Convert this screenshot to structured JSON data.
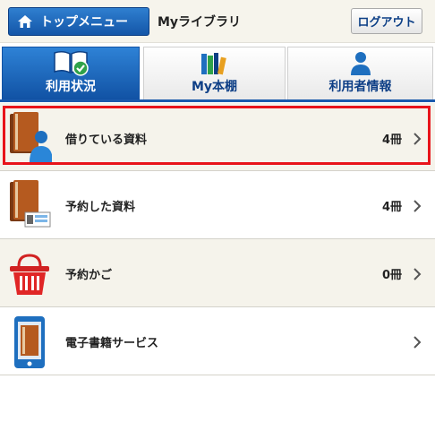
{
  "header": {
    "top_menu_label": "トップメニュー",
    "library_title": "Myライブラリ",
    "logout_label": "ログアウト"
  },
  "tabs": [
    {
      "label": "利用状況",
      "active": true,
      "icon": "book-check-icon"
    },
    {
      "label": "My本棚",
      "active": false,
      "icon": "bookshelf-icon"
    },
    {
      "label": "利用者情報",
      "active": false,
      "icon": "person-icon"
    }
  ],
  "menu": [
    {
      "label": "借りている資料",
      "count": "4冊",
      "icon": "borrowed-books-icon",
      "highlighted": true
    },
    {
      "label": "予約した資料",
      "count": "4冊",
      "icon": "reserved-books-icon",
      "highlighted": false
    },
    {
      "label": "予約かご",
      "count": "0冊",
      "icon": "basket-icon",
      "highlighted": false
    },
    {
      "label": "電子書籍サービス",
      "count": "",
      "icon": "ebook-tablet-icon",
      "highlighted": false
    }
  ],
  "colors": {
    "accent": "#1a5aad",
    "highlight": "#e8131a",
    "row_bg": "#f5f3eb"
  }
}
